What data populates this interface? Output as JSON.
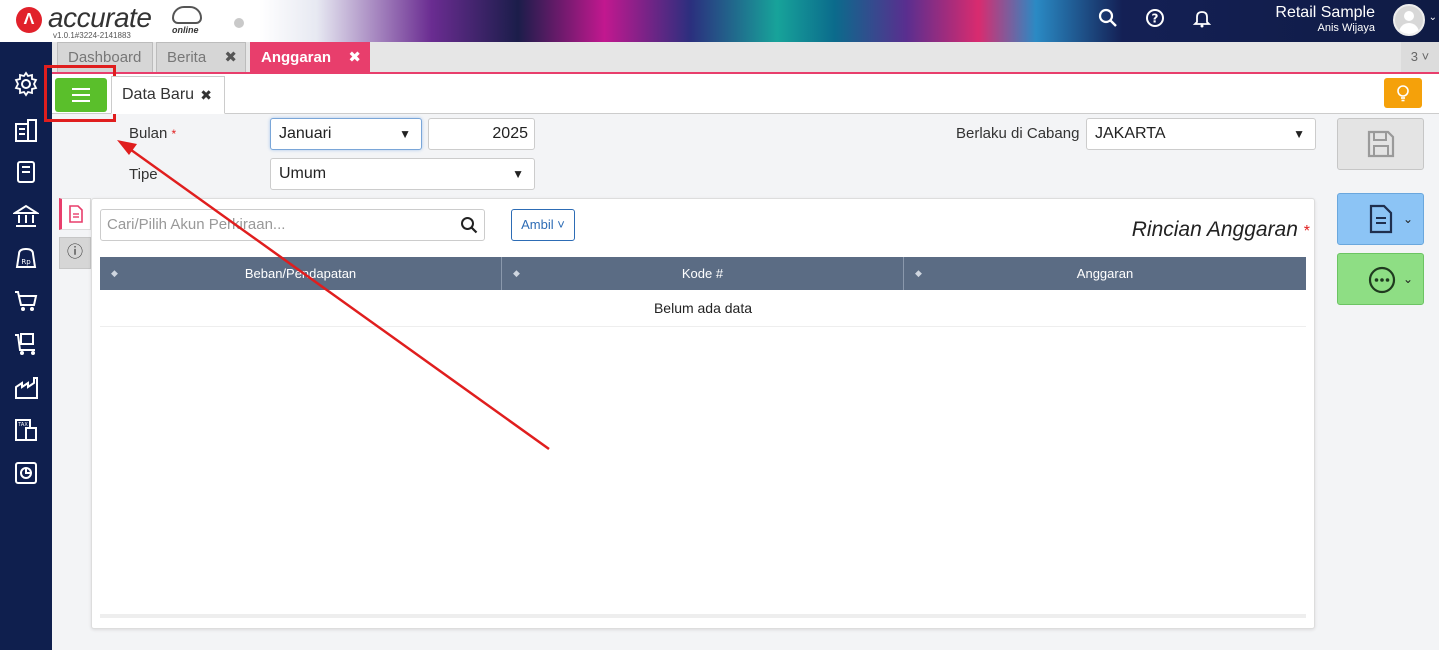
{
  "app": {
    "logo_text": "accurate",
    "logo_sub": "online",
    "version": "v1.0.1#3224-2141883",
    "company": "Retail Sample",
    "user": "Anis Wijaya"
  },
  "tabs": [
    {
      "label": "Dashboard"
    },
    {
      "label": "Berita",
      "close": "✖"
    },
    {
      "label": "Anggaran",
      "close": "✖"
    }
  ],
  "tab_count": "3 ˅",
  "subtab": {
    "label": "Data Baru",
    "close": "✖"
  },
  "form": {
    "bulan_label": "Bulan",
    "required_mark": "*",
    "bulan_value": "Januari",
    "tahun_value": "2025",
    "tipe_label": "Tipe",
    "tipe_value": "Umum",
    "cabang_label": "Berlaku di Cabang",
    "cabang_value": "JAKARTA"
  },
  "detail": {
    "search_placeholder": "Cari/Pilih Akun Perkiraan...",
    "ambil_label": "Ambil ˅",
    "title": "Rincian Anggaran",
    "columns": [
      "Beban/Pendapatan",
      "Kode #",
      "Anggaran"
    ],
    "empty_text": "Belum ada data"
  },
  "colors": {
    "sidebar": "#0f1f4e",
    "active_tab": "#e83e6c",
    "list_button": "#5abf2b",
    "table_header": "#5b6c84",
    "highlight": "#e01e1e"
  }
}
